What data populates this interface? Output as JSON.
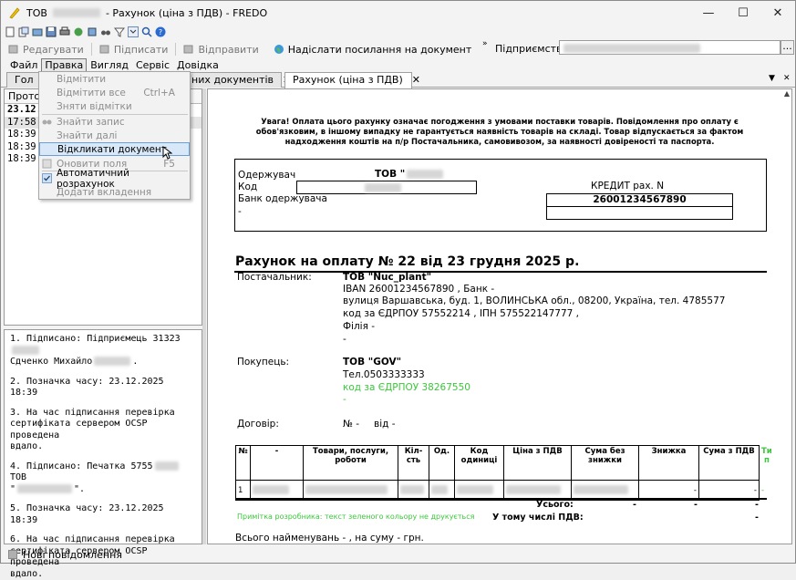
{
  "window": {
    "title_prefix": "ТОВ",
    "title_suffix": "- Рахунок (ціна з ПДВ) - FREDO",
    "minimize": "—",
    "maximize": "☐",
    "close": "✕"
  },
  "toolbar": {
    "actions": [
      {
        "label": "Редагувати",
        "enabled": false
      },
      {
        "label": "Підписати",
        "enabled": false
      },
      {
        "label": "Відправити",
        "enabled": false
      },
      {
        "label": "Надіслати посилання на документ",
        "enabled": true
      }
    ],
    "enterprise_label": "Підприємство",
    "enterprise_button": "..."
  },
  "menu": [
    "Файл",
    "Правка",
    "Вигляд",
    "Сервіс",
    "Довідка"
  ],
  "tabs": [
    {
      "label": "Гол",
      "active": false
    },
    {
      "label": "них документів",
      "active": false
    },
    {
      "label": "Рахунок (ціна з ПДВ)",
      "active": true
    }
  ],
  "dropdown": [
    {
      "label": "Відмітити",
      "shortcut": "",
      "disabled": true
    },
    {
      "label": "Відмітити все",
      "shortcut": "Ctrl+A",
      "disabled": true
    },
    {
      "label": "Зняти відмітки",
      "shortcut": "",
      "disabled": true
    },
    {
      "label": "Знайти запис",
      "shortcut": "",
      "disabled": true
    },
    {
      "label": "Знайти далі",
      "shortcut": "",
      "disabled": true
    },
    {
      "label": "Відкликати документ",
      "shortcut": "",
      "disabled": false,
      "highlighted": true
    },
    {
      "label": "Оновити поля",
      "shortcut": "F5",
      "disabled": true
    },
    {
      "label": "Автоматичний розрахунок",
      "shortcut": "",
      "disabled": false,
      "checked": true
    },
    {
      "label": "Додати вкладення",
      "shortcut": "",
      "disabled": true
    }
  ],
  "left_panel": {
    "header": "Протон",
    "rows": [
      "23.12.",
      "17:58",
      "18:39",
      "18:39",
      "18:39"
    ],
    "signatures": [
      {
        "line1": "1. Підписано: Підприємець 31323",
        "line2": "Сдченко Михайло",
        "line3": "."
      },
      {
        "line1": "2. Позначка часу: 23.12.2025 18:39"
      },
      {
        "line1": "3. На час підписання перевірка",
        "line2": "сертифіката сервером OCSP проведена",
        "line3": "вдало."
      },
      {
        "line1": "4. Підписано: Печатка 5755",
        "line1b": "ТОВ",
        "line2": "\"",
        "line3": "\"."
      },
      {
        "line1": "5. Позначка часу: 23.12.2025 18:39"
      },
      {
        "line1": "6. На час підписання перевірка",
        "line2": "сертифіката сервером OCSP проведена",
        "line3": "вдало."
      }
    ]
  },
  "status": {
    "messages": "Нові повідомлення"
  },
  "document": {
    "notice": "Увага! Оплата цього рахунку означає погодження з умовами поставки товарів. Повідомлення про оплату є обов'язковим, в іншому випадку не гарантується наявність товарів на складі. Товар відпускається за фактом надходження коштів на п/р Постачальника, самовивозом, за наявності довіреності та паспорта.",
    "recipient_label": "Одержувач",
    "recipient_name": "ТОВ \"",
    "code_label": "Код",
    "bank_label": "Банк одержувача",
    "dash": "-",
    "credit_label": "КРЕДИТ рах. N",
    "credit_account": "26001234567890",
    "title": "Рахунок на оплату № 22 від 23 грудня 2025 р.",
    "supplier_label": "Постачальник:",
    "supplier_name": "ТОВ \"Nuc_plant\"",
    "supplier_iban": "IBAN 26001234567890 , Банк -",
    "supplier_address": "вулиця Варшавська, буд. 1, ВОЛИНСЬКА обл., 08200, Україна, тел. 4785577",
    "supplier_codes": "код за ЄДРПОУ 57552214 , ІПН 575522147777 ,",
    "supplier_branch": "Філія -",
    "supplier_dash": "-",
    "buyer_label": "Покупець:",
    "buyer_name": "ТОВ \"GOV\"",
    "buyer_phone": "Тел.0503333333",
    "buyer_code": "код за ЄДРПОУ 38267550",
    "buyer_dash": "-",
    "contract_label": "Договір:",
    "contract_no": "№ -",
    "contract_from": "від -",
    "table_headers": [
      "№",
      "-",
      "Товари, послуги, роботи",
      "Кіл-сть",
      "Од.",
      "Код одиниці",
      "Ціна з ПДВ",
      "Сума без знижки",
      "Знижка",
      "Сума з ПДВ",
      "Ти п"
    ],
    "table_row": {
      "n": "1",
      "discount": "-",
      "sum": "-",
      "extra": "-"
    },
    "total_label": "Усього:",
    "total_values": [
      "-",
      "-",
      "-"
    ],
    "vat_label": "У тому числі ПДВ:",
    "vat_value": "-",
    "note": "Примітка розробника: текст зеленого кольору не друкується",
    "summary": "Всього найменувань - , на суму -  грн."
  }
}
